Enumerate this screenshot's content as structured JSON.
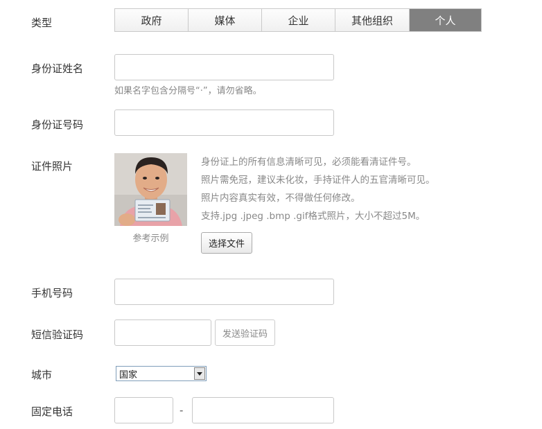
{
  "type": {
    "label": "类型",
    "options": [
      "政府",
      "媒体",
      "企业",
      "其他组织",
      "个人"
    ],
    "selected": "个人"
  },
  "id_name": {
    "label": "身份证姓名",
    "value": "",
    "hint": "如果名字包含分隔号“·”，请勿省略。"
  },
  "id_number": {
    "label": "身份证号码",
    "value": ""
  },
  "id_photo": {
    "label": "证件照片",
    "example_caption": "参考示例",
    "requirements": [
      "身份证上的所有信息清晰可见，必须能看清证件号。",
      "照片需免冠，建议未化妆，手持证件人的五官清晰可见。",
      "照片内容真实有效，不得做任何修改。",
      "支持.jpg .jpeg .bmp .gif格式照片，大小不超过5M。"
    ],
    "choose_file_label": "选择文件"
  },
  "phone": {
    "label": "手机号码",
    "value": ""
  },
  "sms_code": {
    "label": "短信验证码",
    "value": "",
    "send_button_label": "发送验证码"
  },
  "city": {
    "label": "城市",
    "selected": "国家"
  },
  "landline": {
    "label": "固定电话",
    "area_code": "",
    "number": "",
    "separator": "-"
  },
  "colors": {
    "active_segment": "#808080",
    "border": "#c8c8c8",
    "hint_text": "#888888"
  }
}
